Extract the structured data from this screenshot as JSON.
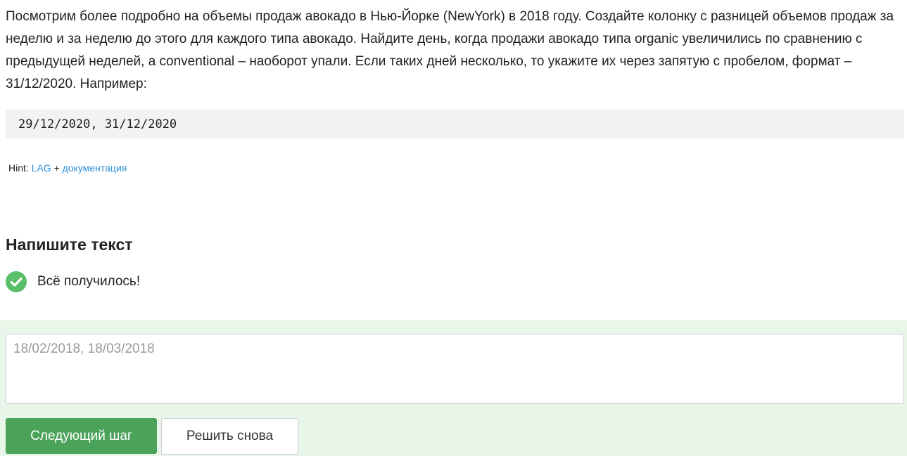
{
  "task": {
    "text": "Посмотрим более подробно на объемы продаж авокадо в Нью-Йорке (NewYork) в 2018 году. Создайте колонку с разницей объемов продаж за неделю и за неделю до этого для каждого типа авокадо. Найдите день, когда продажи авокадо типа organic увеличились по сравнению с предыдущей неделей, а conventional – наоборот упали. Если таких дней несколько, то укажите их через запятую с пробелом, формат – 31/12/2020. Например:",
    "example_code": "29/12/2020, 31/12/2020"
  },
  "hint": {
    "prefix": "Hint:",
    "link1": "LAG",
    "separator": "+",
    "link2": "документация"
  },
  "answer_section": {
    "title": "Напишите текст",
    "status_text": "Всё получилось!",
    "status_color": "#5bbf6a",
    "input_value": "18/02/2018, 18/03/2018",
    "next_button": "Следующий шаг",
    "retry_button": "Решить снова",
    "panel_color": "#e8f5e9",
    "accent_color": "#4ba35a",
    "link_color": "#2a8fd8"
  }
}
